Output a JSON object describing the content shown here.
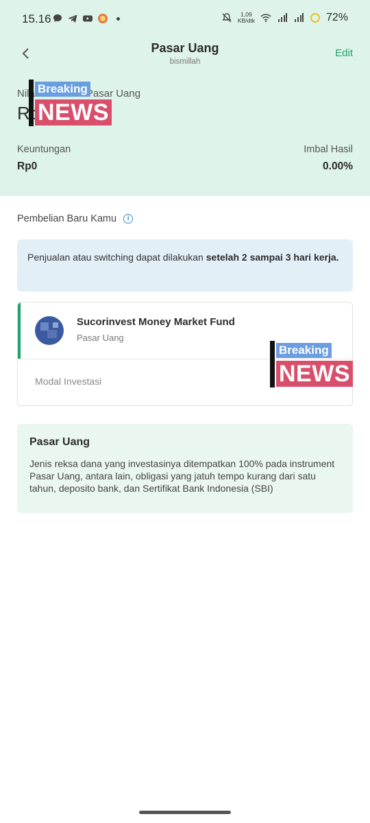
{
  "status_bar": {
    "time": "15.16",
    "net_speed_value": "1,09",
    "net_speed_unit": "KB/dtk",
    "battery": "72%"
  },
  "nav": {
    "title": "Pasar Uang",
    "subtitle": "bismillah",
    "edit_label": "Edit"
  },
  "portfolio": {
    "value_label": "Nilai Portofolio Pasar Uang",
    "value": "Rp0",
    "profit_label": "Keuntungan",
    "profit_value": "Rp0",
    "return_label": "Imbal Hasil",
    "return_value": "0.00%"
  },
  "overlay_badges": [
    {
      "top_word": "Breaking",
      "bottom_word": "NEWS"
    },
    {
      "top_word": "Breaking",
      "bottom_word": "NEWS"
    }
  ],
  "new_purchase": {
    "title": "Pembelian Baru Kamu",
    "notice_text": "Penjualan atau switching dapat dilakukan ",
    "notice_bold": "setelah 2 sampai 3 hari kerja."
  },
  "fund": {
    "name": "Sucorinvest Money Market Fund",
    "category": "Pasar Uang",
    "modal_label": "Modal Investasi"
  },
  "description": {
    "title": "Pasar Uang",
    "text": "Jenis reksa dana yang investasinya ditempatkan 100% pada instrument Pasar Uang, antara lain, obligasi yang jatuh tempo kurang dari satu tahun, deposito bank, dan Sertifikat Bank Indonesia (SBI)"
  },
  "colors": {
    "header_bg": "#def3ea",
    "accent_green": "#1aa36a",
    "notice_bg": "#e3eff7",
    "description_bg": "#eaf6f0",
    "badge_blue": "#6a9ee0",
    "badge_red": "#d94f6b"
  }
}
